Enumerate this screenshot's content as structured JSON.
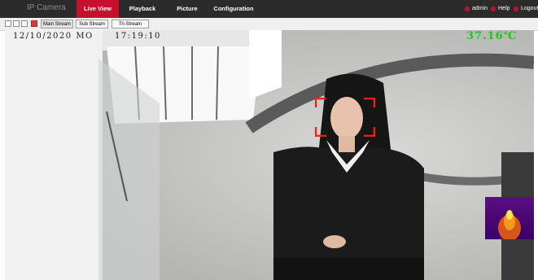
{
  "header": {
    "brand": "IP Camera",
    "nav": [
      "Live View",
      "Playback",
      "Picture",
      "Configuration"
    ],
    "active_nav": "Live View",
    "user": "admin",
    "help": "Help",
    "logout": "Logout"
  },
  "toolbar": {
    "icons": [
      "layout-1-icon",
      "layout-4-icon",
      "fullscreen-icon",
      "record-icon"
    ],
    "streams": [
      "Main Stream",
      "Sub Stream",
      "Tri-Stream"
    ],
    "selected_stream": "Main Stream"
  },
  "video": {
    "osd_date": "12/10/2020 MO",
    "osd_time": "17:19:10",
    "temperature": "37.16℃"
  },
  "colors": {
    "accent": "#c8102e",
    "topbar": "#2b2b2b",
    "temperature": "#22c21f",
    "face_box": "#ff1a1a"
  }
}
